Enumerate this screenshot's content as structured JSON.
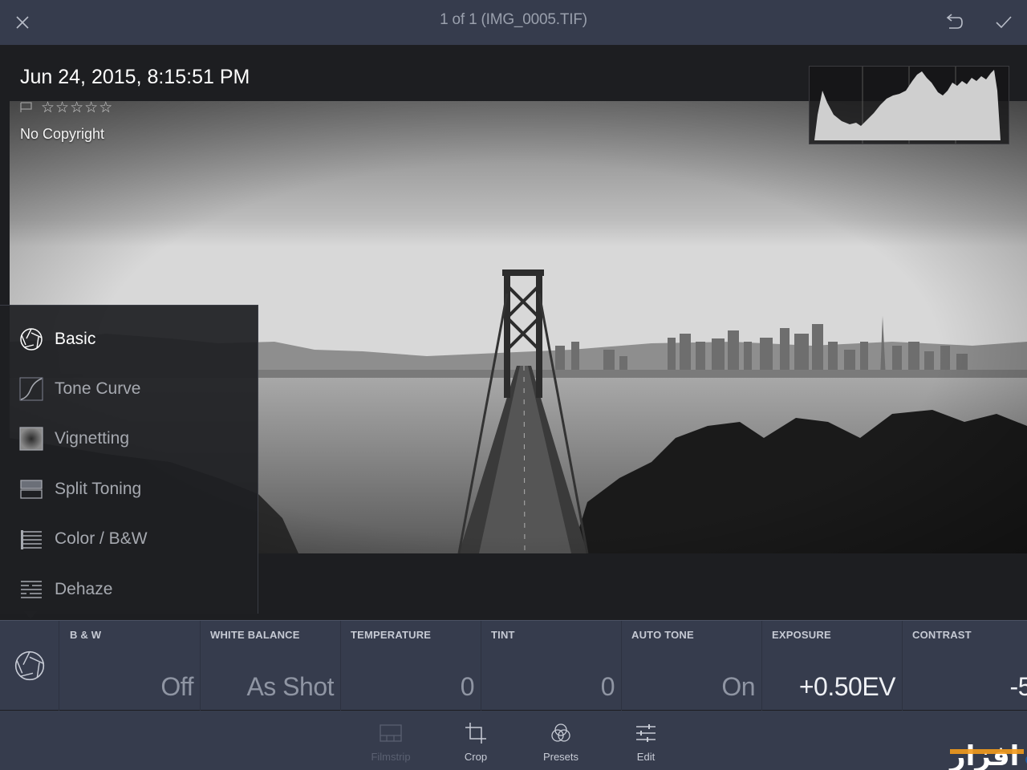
{
  "topbar": {
    "title": "1 of 1 (IMG_0005.TIF)",
    "close_icon": "close-icon",
    "undo_icon": "undo-icon",
    "confirm_icon": "checkmark-icon"
  },
  "metadata": {
    "date": "Jun 24, 2015, 8:15:51 PM",
    "flag_icon": "flag-icon",
    "rating": 0,
    "max_rating": 5,
    "copyright": "No Copyright"
  },
  "tools": {
    "items": [
      {
        "label": "Basic",
        "icon": "aperture-icon",
        "active": true
      },
      {
        "label": "Tone Curve",
        "icon": "tone-curve-icon",
        "active": false
      },
      {
        "label": "Vignetting",
        "icon": "vignette-icon",
        "active": false
      },
      {
        "label": "Split Toning",
        "icon": "split-toning-icon",
        "active": false
      },
      {
        "label": "Color / B&W",
        "icon": "color-bw-icon",
        "active": false
      },
      {
        "label": "Dehaze",
        "icon": "dehaze-icon",
        "active": false
      }
    ]
  },
  "settings": {
    "panel_icon": "aperture-icon",
    "cells": [
      {
        "label": "B & W",
        "value": "Off"
      },
      {
        "label": "WHITE BALANCE",
        "value": "As Shot"
      },
      {
        "label": "TEMPERATURE",
        "value": "0"
      },
      {
        "label": "TINT",
        "value": "0"
      },
      {
        "label": "AUTO TONE",
        "value": "On"
      },
      {
        "label": "EXPOSURE",
        "value": "+0.50EV"
      },
      {
        "label": "CONTRAST",
        "value": "-5"
      }
    ]
  },
  "bottombar": {
    "buttons": [
      {
        "label": "Filmstrip",
        "icon": "filmstrip-icon",
        "enabled": false
      },
      {
        "label": "Crop",
        "icon": "crop-icon",
        "enabled": true
      },
      {
        "label": "Presets",
        "icon": "presets-icon",
        "enabled": true
      },
      {
        "label": "Edit",
        "icon": "sliders-icon",
        "enabled": true
      }
    ]
  },
  "watermark": {
    "text": "سجت افزار"
  },
  "colors": {
    "bar_background": "#363c4d",
    "panel_background": "#1e1f22",
    "active_text": "#ffffff",
    "inactive_text": "#a6a9b0",
    "watermark_blue": "#1a5fa8",
    "watermark_orange": "#f29a1d"
  }
}
